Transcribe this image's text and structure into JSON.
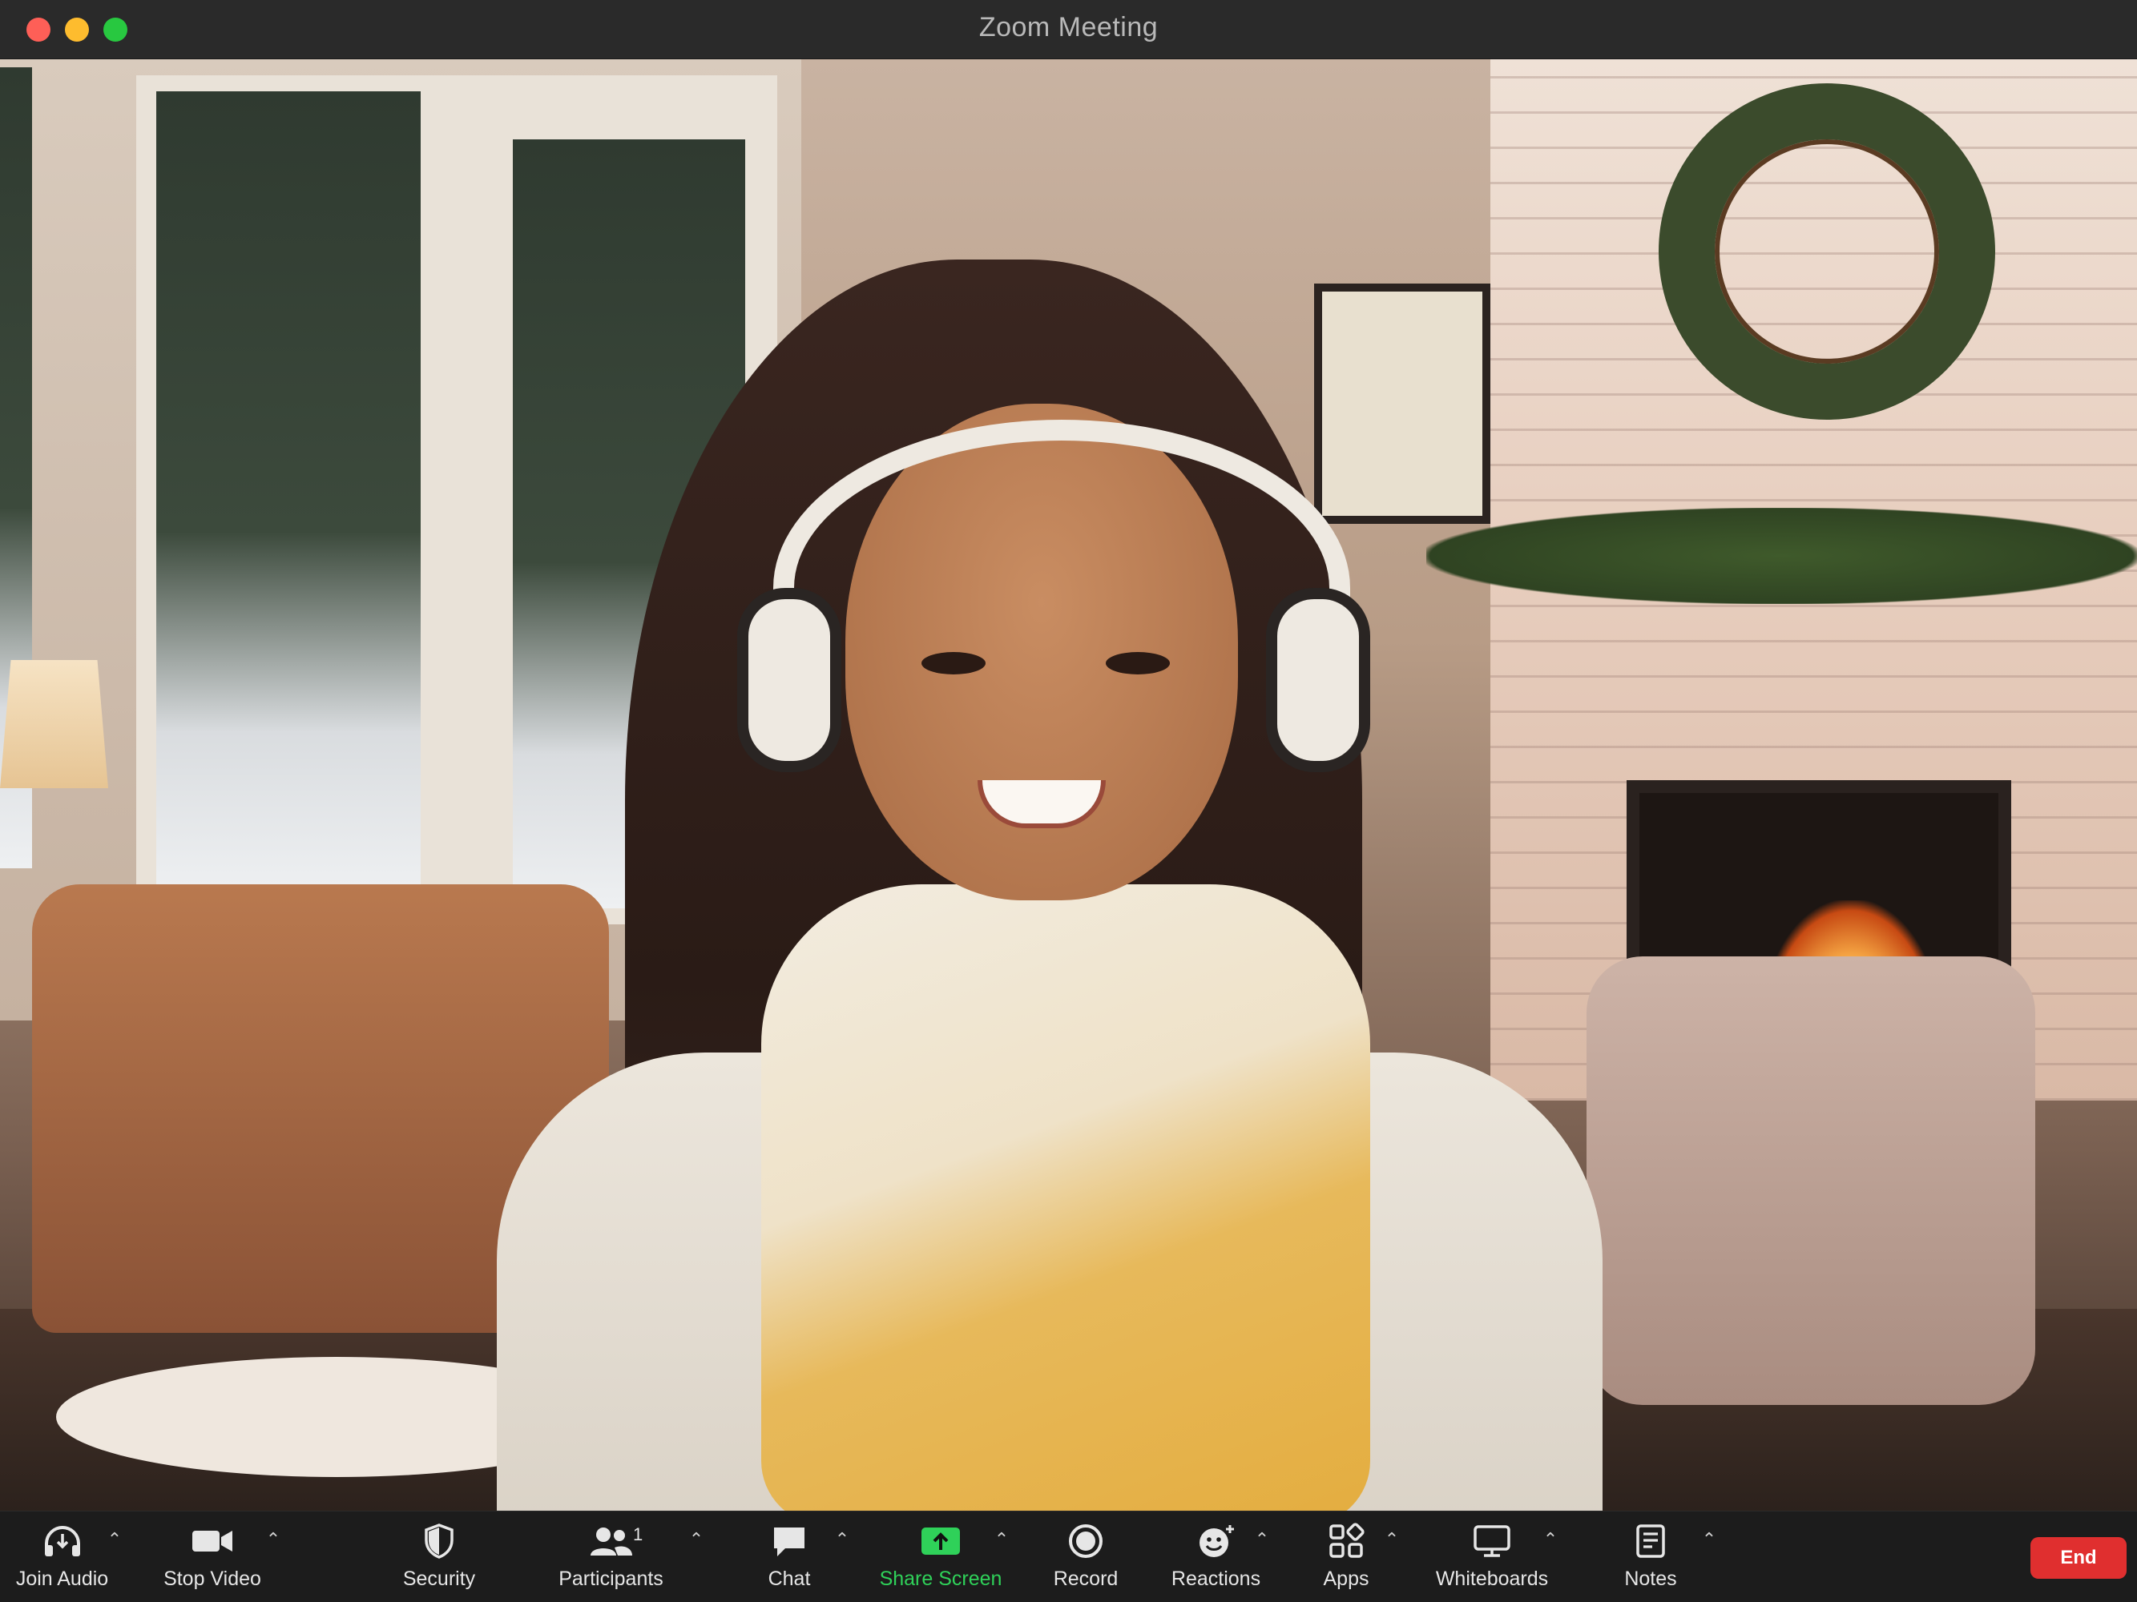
{
  "window": {
    "title": "Zoom Meeting"
  },
  "toolbar": {
    "items": [
      {
        "label": "Join Audio",
        "icon": "headphones-icon"
      },
      {
        "label": "Stop Video",
        "icon": "video-camera-icon"
      },
      {
        "label": "Security",
        "icon": "shield-icon"
      },
      {
        "label": "Participants",
        "icon": "participants-icon",
        "count": "1"
      },
      {
        "label": "Chat",
        "icon": "chat-bubble-icon"
      },
      {
        "label": "Share Screen",
        "icon": "share-screen-icon"
      },
      {
        "label": "Record",
        "icon": "record-icon"
      },
      {
        "label": "Reactions",
        "icon": "reactions-icon"
      },
      {
        "label": "Apps",
        "icon": "apps-icon"
      },
      {
        "label": "Whiteboards",
        "icon": "whiteboard-icon"
      },
      {
        "label": "Notes",
        "icon": "notes-icon"
      }
    ],
    "end_label": "End",
    "share_color": "#2fd159",
    "end_color": "#e02f2f"
  }
}
